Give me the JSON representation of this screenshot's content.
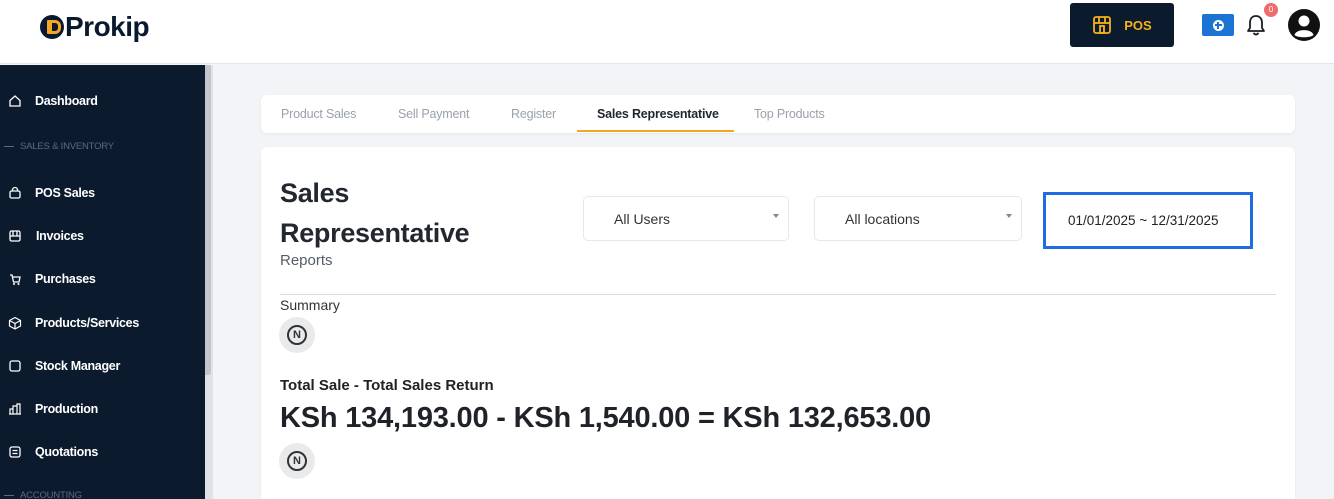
{
  "header": {
    "logo_text": "Prokip",
    "pos_label": "POS",
    "notification_count": "0"
  },
  "sidebar": {
    "items": [
      {
        "label": "Dashboard",
        "icon": "home-icon"
      },
      {
        "section": "SALES & INVENTORY"
      },
      {
        "label": "POS Sales",
        "icon": "cart-icon"
      },
      {
        "label": "Invoices",
        "icon": "invoice-icon"
      },
      {
        "label": "Purchases",
        "icon": "purchase-icon"
      },
      {
        "label": "Products/Services",
        "icon": "box-icon"
      },
      {
        "label": "Stock Manager",
        "icon": "stock-icon"
      },
      {
        "label": "Production",
        "icon": "production-icon"
      },
      {
        "label": "Quotations",
        "icon": "quotation-icon"
      },
      {
        "section": "ACCOUNTING"
      }
    ]
  },
  "tabs": [
    {
      "label": "Product Sales",
      "active": false
    },
    {
      "label": "Sell Payment",
      "active": false
    },
    {
      "label": "Register",
      "active": false
    },
    {
      "label": "Sales Representative",
      "active": true
    },
    {
      "label": "Top Products",
      "active": false
    }
  ],
  "page": {
    "title": "Sales Representative",
    "subtitle": "Reports",
    "users_filter": "All Users",
    "locations_filter": "All locations",
    "date_range": "01/01/2025 ~ 12/31/2025",
    "summary_label": "Summary",
    "total_label": "Total Sale - Total Sales Return",
    "total_value": "KSh 134,193.00 - KSh 1,540.00 = KSh 132,653.00",
    "badge_letter": "N"
  },
  "colors": {
    "sidebar_bg": "#0c1a2e",
    "accent": "#f5a623",
    "highlight_border": "#1f6be0",
    "add_button": "#1b74d4"
  }
}
